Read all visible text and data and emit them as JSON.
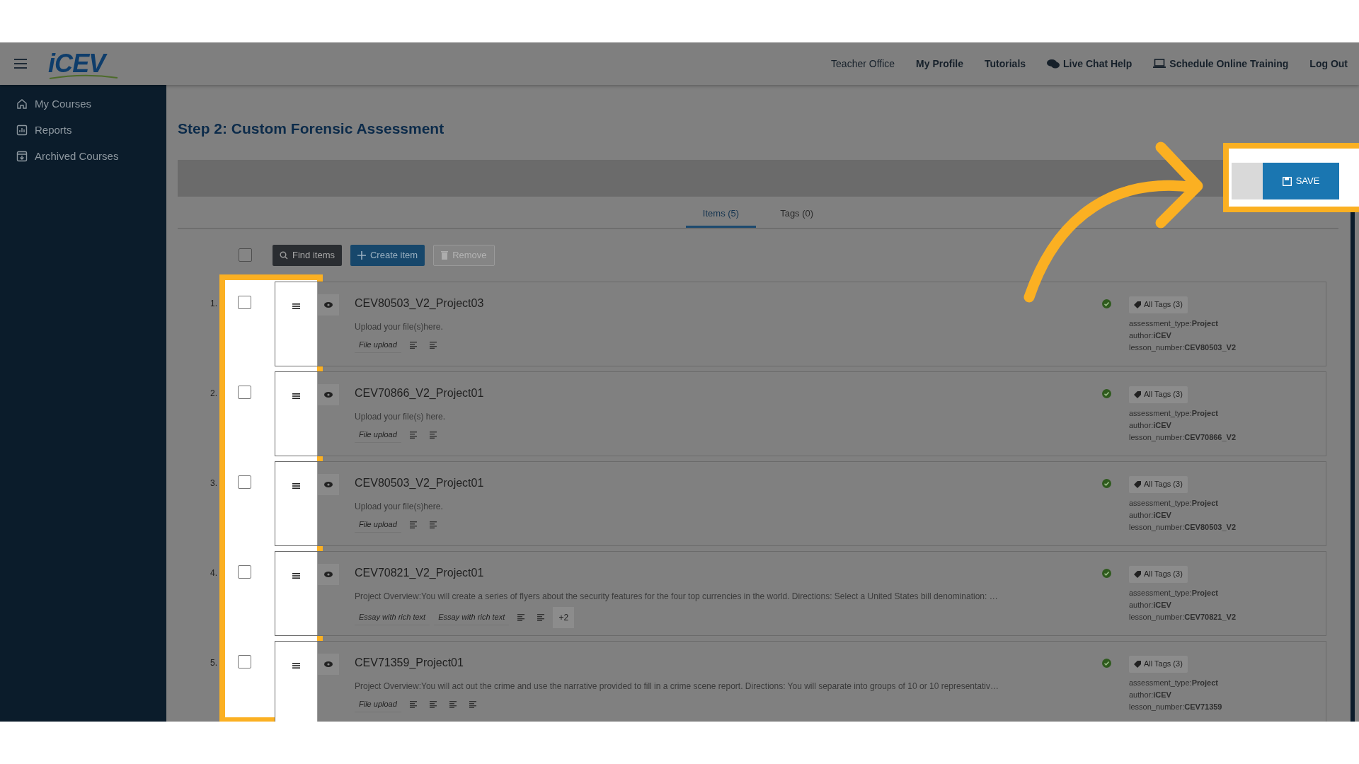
{
  "header": {
    "logo": "iCEV",
    "nav": [
      {
        "label": "Teacher Office",
        "kind": "plain"
      },
      {
        "label": "My Profile",
        "kind": "bold"
      },
      {
        "label": "Tutorials",
        "kind": "bold"
      },
      {
        "label": "Live Chat Help",
        "kind": "chat"
      },
      {
        "label": "Schedule Online Training",
        "kind": "laptop"
      },
      {
        "label": "Log Out",
        "kind": "bold"
      }
    ]
  },
  "sidebar": {
    "items": [
      {
        "label": "My Courses",
        "kind": "home"
      },
      {
        "label": "Reports",
        "kind": "chart"
      },
      {
        "label": "Archived Courses",
        "kind": "archive"
      }
    ]
  },
  "page_title": "Step 2: Custom Forensic Assessment",
  "save_button": "SAVE",
  "tabs": [
    {
      "label": "Items (5)",
      "selected": true
    },
    {
      "label": "Tags (0)",
      "selected": false
    }
  ],
  "toolbar": {
    "select_all_checked": false,
    "buttons": [
      {
        "label": "Find items",
        "kind": "search",
        "disabled": false
      },
      {
        "label": "Create item",
        "kind": "create",
        "disabled": false
      },
      {
        "label": "Remove",
        "kind": "remove",
        "disabled": true
      }
    ]
  },
  "items": [
    {
      "number": "1.",
      "checked": false,
      "title": "CEV80503_V2_Project03",
      "description": "Upload your file(s)here.",
      "chips": [
        {
          "kind": "label",
          "text": "File upload"
        },
        {
          "kind": "icon"
        },
        {
          "kind": "icon"
        }
      ],
      "tags_button": "All Tags (3)",
      "tags": [
        "assessment_type:**Project**",
        "author:**iCEV**",
        "lesson_number:**CEV80503_V2**"
      ]
    },
    {
      "number": "2.",
      "checked": false,
      "title": "CEV70866_V2_Project01",
      "description": "Upload your file(s) here.",
      "chips": [
        {
          "kind": "label",
          "text": "File upload"
        },
        {
          "kind": "icon"
        },
        {
          "kind": "icon"
        }
      ],
      "tags_button": "All Tags (3)",
      "tags": [
        "assessment_type:**Project**",
        "author:**iCEV**",
        "lesson_number:**CEV70866_V2**"
      ]
    },
    {
      "number": "3.",
      "checked": false,
      "title": "CEV80503_V2_Project01",
      "description": "Upload your file(s)here.",
      "chips": [
        {
          "kind": "label",
          "text": "File upload"
        },
        {
          "kind": "icon"
        },
        {
          "kind": "icon"
        }
      ],
      "tags_button": "All Tags (3)",
      "tags": [
        "assessment_type:**Project**",
        "author:**iCEV**",
        "lesson_number:**CEV80503_V2**"
      ]
    },
    {
      "number": "4.",
      "checked": false,
      "title": "CEV70821_V2_Project01",
      "description": "Project Overview:You will create a series of flyers about the security features for the four top currencies in the world. Directions: Select a United States bill denomination: …",
      "chips": [
        {
          "kind": "label",
          "text": "Essay with rich text"
        },
        {
          "kind": "label",
          "text": "Essay with rich text"
        },
        {
          "kind": "icon"
        },
        {
          "kind": "icon"
        },
        {
          "kind": "count",
          "text": "+2"
        }
      ],
      "tags_button": "All Tags (3)",
      "tags": [
        "assessment_type:**Project**",
        "author:**iCEV**",
        "lesson_number:**CEV70821_V2**"
      ]
    },
    {
      "number": "5.",
      "checked": false,
      "title": "CEV71359_Project01",
      "description": "Project Overview:You will act out the crime and use the narrative provided to fill in a crime scene report. Directions: You will separate into groups of 10 or 10 representativ…",
      "chips": [
        {
          "kind": "label",
          "text": "File upload"
        },
        {
          "kind": "icon"
        },
        {
          "kind": "icon"
        },
        {
          "kind": "icon"
        },
        {
          "kind": "icon"
        }
      ],
      "tags_button": "All Tags (3)",
      "tags": [
        "assessment_type:**Project**",
        "author:**iCEV**",
        "lesson_number:**CEV71359**"
      ]
    }
  ]
}
